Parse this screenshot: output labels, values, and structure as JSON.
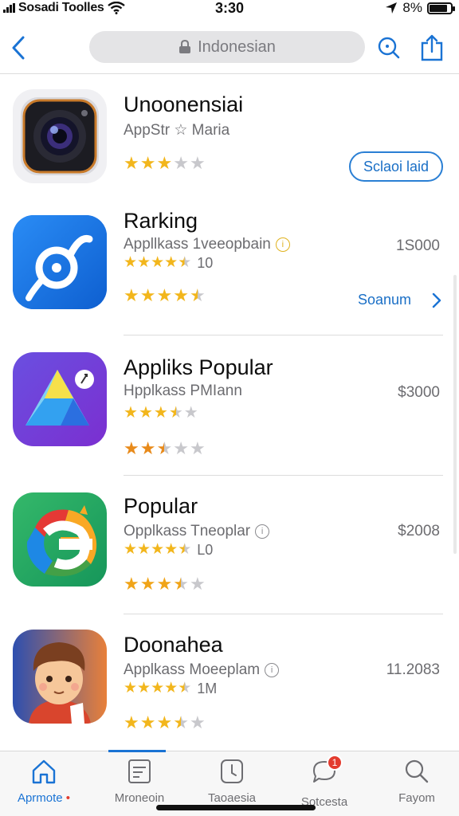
{
  "status_bar": {
    "carrier": "Sosadi Toolles",
    "time": "3:30",
    "battery": "8%",
    "battery_level": 0.85
  },
  "search": {
    "placeholder": "Indonesian"
  },
  "icons": {
    "back": "chevron-left-icon",
    "lock": "lock-icon",
    "search": "search-icon",
    "share": "share-icon",
    "home": "home-icon",
    "today": "document-icon",
    "updates": "clock-icon",
    "messages": "chat-icon",
    "explore": "search-icon"
  },
  "colors": {
    "accent": "#1a73d4",
    "star": "#f2b61c",
    "badge": "#e33b2e"
  },
  "apps": [
    {
      "name": "Unoonensiai",
      "subtitle": "AppStr ☆ Maria",
      "rating": 3,
      "action_label": "Sclaoi laid"
    },
    {
      "name": "Rarking",
      "subtitle": "Appllkass 1veeopbain",
      "rating_count": "10",
      "rating": 4.5,
      "price": "1S000",
      "link_label": "Soanum"
    },
    {
      "name": "Appliks Popular",
      "subtitle": "Hpplkass PMIann",
      "rating": 3.5,
      "rating2": 2.5,
      "price": "$3000"
    },
    {
      "name": "Popular",
      "subtitle": "Opplkass Tneoplar",
      "rating_count": "L0",
      "rating": 4.5,
      "rating2": 3.5,
      "price": "$2008"
    },
    {
      "name": "Doonahea",
      "subtitle": "Applkass Moeeplam",
      "rating_count": "1M",
      "rating": 4.5,
      "rating2": 3.5,
      "price": "11.2083"
    }
  ],
  "tabs": [
    {
      "label": "Aprmote",
      "active": true
    },
    {
      "label": "Mroneoin"
    },
    {
      "label": "Taoaesia"
    },
    {
      "label": "Sotcesta",
      "badge": "1"
    },
    {
      "label": "Fayom"
    }
  ]
}
